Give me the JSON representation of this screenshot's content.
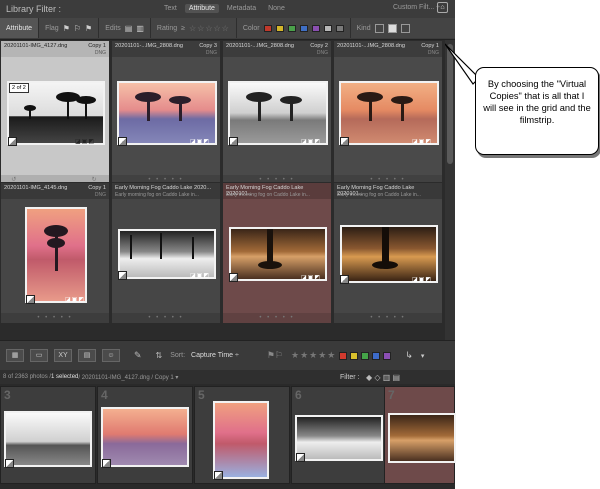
{
  "filter_bar": {
    "title": "Library Filter :",
    "tabs": [
      "Text",
      "Attribute",
      "Metadata",
      "None"
    ],
    "active_tab": "Attribute",
    "preset": "Custom Filt... ÷",
    "attribute_label": "Attribute",
    "flag_label": "Flag",
    "edits_label": "Edits",
    "rating_label": "Rating",
    "rating_op": "≥",
    "color_label": "Color",
    "kind_label": "Kind",
    "color_swatches": [
      "#c0392b",
      "#d4b62a",
      "#4aa04a",
      "#3f6fc4",
      "#8a4fb0",
      "#b8b8b8",
      "#7a7a7a"
    ]
  },
  "grid": {
    "row1": [
      {
        "name": "20201101-IMG_4127.dng",
        "copy": "Copy 1",
        "ext": "DNG",
        "badge": "2 of 2"
      },
      {
        "name": "20201101-...IMG_2808.dng",
        "copy": "Copy 3",
        "ext": "DNG"
      },
      {
        "name": "20201101-...IMG_2808.dng",
        "copy": "Copy 2",
        "ext": "DNG"
      },
      {
        "name": "20201101-...IMG_2808.dng",
        "copy": "Copy 1",
        "ext": "DNG"
      }
    ],
    "row2": [
      {
        "name": "20201101-IMG_4145.dng",
        "copy": "Copy 1",
        "ext": "DNG"
      },
      {
        "name": "Early Morning Fog Caddo Lake 2020...",
        "sub": "Early morning fog on Caddo Lake in..."
      },
      {
        "name": "Early Morning Fog Caddo Lake 2020101...",
        "sub": "Early morning fog on Caddo Lake in..."
      },
      {
        "name": "Early Morning Fog Caddo Lake 2020101...",
        "sub": "Early morning fog on Caddo Lake in..."
      }
    ],
    "dots": "• • • • •"
  },
  "toolbar": {
    "sort_label": "Sort:",
    "sort_value": "Capture Time ÷",
    "stars": "★★★★★",
    "swatches": [
      "#d23a2e",
      "#d9c02c",
      "#44a348",
      "#3d6bc9",
      "#8b4fb5"
    ]
  },
  "filmstrip_bar": {
    "count": "8 of 2363 photos /",
    "selected": "1 selected",
    "path": "/ 20201101-IMG_4127.dng / Copy 1 ▾",
    "filter_label": "Filter :"
  },
  "filmstrip": {
    "numbers": [
      "3",
      "4",
      "5",
      "6",
      "7"
    ]
  },
  "callout": {
    "text": "By choosing the \"Virtual Copies\" that is all that I will see in the grid and the filmstrip."
  }
}
